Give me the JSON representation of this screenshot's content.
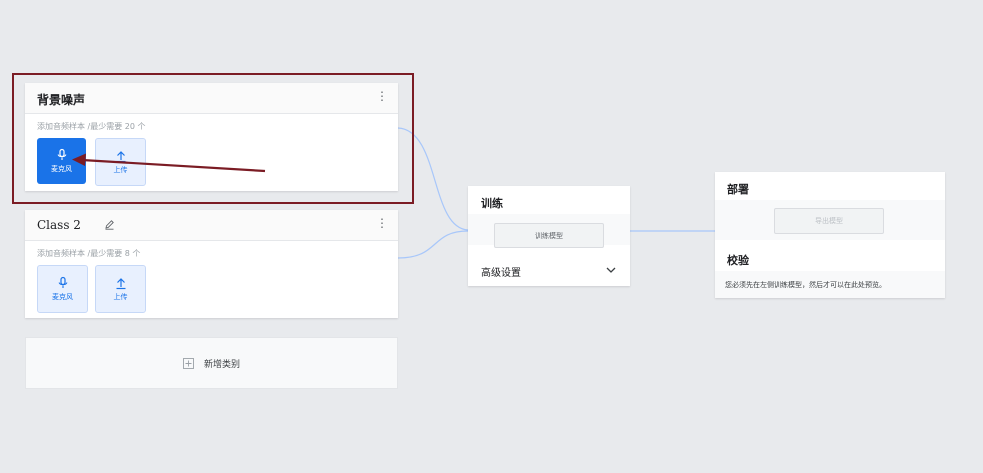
{
  "classes": [
    {
      "title": "背景噪声",
      "hint": "添加音频样本 /最少需要 20 个",
      "mic_label": "麦克风",
      "upload_label": "上传"
    },
    {
      "title": "Class 2",
      "hint": "添加音频样本 /最少需要 8 个",
      "mic_label": "麦克风",
      "upload_label": "上传"
    }
  ],
  "add_class": {
    "label": "新增类别"
  },
  "training": {
    "title": "训练",
    "train_button": "训练模型",
    "advanced_label": "高级设置"
  },
  "deploy": {
    "title": "部署",
    "export_button": "导出模型",
    "preview_title": "校验",
    "preview_message": "您必须先在左侧训练模型，然后才可以在此处预览。"
  },
  "icons": {
    "menu": "kebab-menu-icon",
    "edit": "pencil-icon",
    "mic": "microphone-icon",
    "upload": "upload-icon",
    "add": "plus-box-icon",
    "expand": "chevron-down-icon"
  },
  "colors": {
    "accent": "#1a73e8",
    "highlight_box": "#7b1c24",
    "connector": "#a8c7fa",
    "background": "#e8eaed"
  }
}
